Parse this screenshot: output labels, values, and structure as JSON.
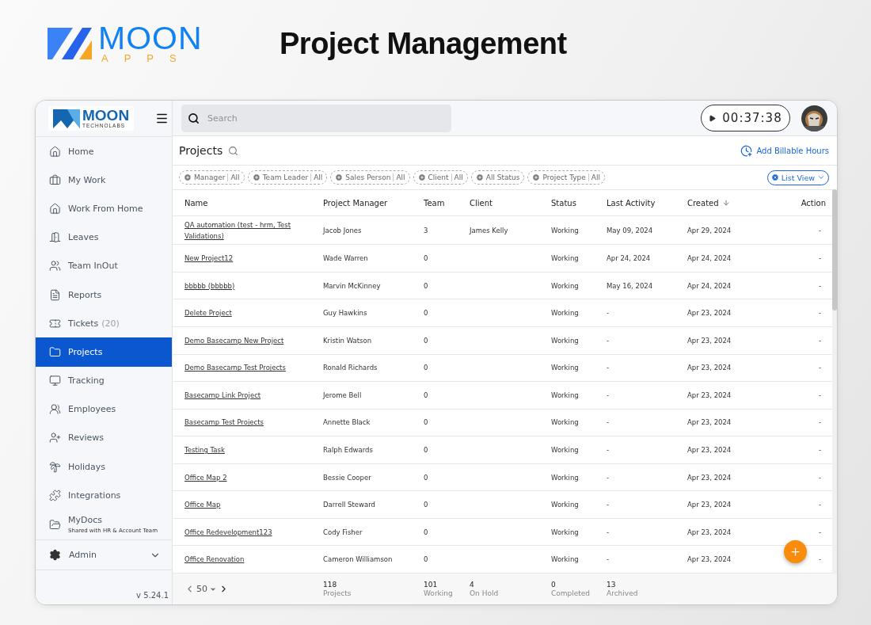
{
  "brand": {
    "name": "MOON",
    "tagline": "APPS"
  },
  "headline": "Project Management",
  "app": {
    "logo": {
      "name": "MOON",
      "sub": "TECHNOLABS"
    },
    "search": {
      "placeholder": "Search"
    },
    "timer": {
      "time": "00:37:38"
    },
    "sidebar": {
      "items": [
        {
          "label": "Home",
          "selected": false
        },
        {
          "label": "My Work",
          "selected": false
        },
        {
          "label": "Work From Home",
          "selected": false
        },
        {
          "label": "Leaves",
          "selected": false
        },
        {
          "label": "Team InOut",
          "selected": false
        },
        {
          "label": "Reports",
          "selected": false
        },
        {
          "label": "Tickets",
          "count": "(20)",
          "selected": false
        },
        {
          "label": "Projects",
          "selected": true
        },
        {
          "label": "Tracking",
          "selected": false
        },
        {
          "label": "Employees",
          "selected": false
        },
        {
          "label": "Reviews",
          "selected": false
        },
        {
          "label": "Holidays",
          "selected": false
        },
        {
          "label": "Integrations",
          "selected": false
        },
        {
          "label": "MyDocs",
          "note": "Shared with HR & Account Team",
          "selected": false
        }
      ],
      "admin": {
        "label": "Admin",
        "expanded": false
      },
      "version": "v 5.24.1"
    },
    "page": {
      "title": "Projects",
      "action": "Add Billable Hours",
      "view": "List View",
      "filters": [
        {
          "label": "Manager",
          "value": "All"
        },
        {
          "label": "Team Leader",
          "value": "All"
        },
        {
          "label": "Sales Person",
          "value": "All"
        },
        {
          "label": "Client",
          "value": "All"
        },
        {
          "label": "All Status"
        },
        {
          "label": "Project Type",
          "value": "All"
        }
      ]
    },
    "table": {
      "columns": [
        {
          "label": "Name"
        },
        {
          "label": "Project Manager"
        },
        {
          "label": "Team"
        },
        {
          "label": "Client"
        },
        {
          "label": "Status"
        },
        {
          "label": "Last Activity"
        },
        {
          "label": "Created",
          "sorted": true
        },
        {
          "label": "Action"
        }
      ],
      "rows": [
        {
          "name": "QA automation (test - hrm, Test Validations)",
          "manager": "Jacob Jones",
          "team": "3",
          "client": "James Kelly",
          "status": "Working",
          "last_activity": "May 09, 2024",
          "created": "Apr 29, 2024",
          "action": "-"
        },
        {
          "name": "New Project12",
          "manager": "Wade Warren",
          "team": "0",
          "status": "Working",
          "last_activity": "Apr 24, 2024",
          "created": "Apr 24, 2024",
          "action": "-"
        },
        {
          "name": "bbbbb (bbbbb)",
          "manager": "Marvin McKinney",
          "team": "0",
          "status": "Working",
          "last_activity": "May 16, 2024",
          "created": "Apr 24, 2024",
          "action": "-"
        },
        {
          "name": "Delete Project",
          "manager": "Guy Hawkins",
          "team": "0",
          "status": "Working",
          "last_activity": "-",
          "created": "Apr 23, 2024",
          "action": "-"
        },
        {
          "name": "Demo Basecamp New Project",
          "manager": "Kristin Watson",
          "team": "0",
          "status": "Working",
          "last_activity": "-",
          "created": "Apr 23, 2024",
          "action": "-"
        },
        {
          "name": "Demo Basecamp Test Projects",
          "manager": "Ronald Richards",
          "team": "0",
          "status": "Working",
          "last_activity": "-",
          "created": "Apr 23, 2024",
          "action": "-"
        },
        {
          "name": "Basecamp Link Project",
          "manager": "Jerome Bell",
          "team": "0",
          "status": "Working",
          "last_activity": "-",
          "created": "Apr 23, 2024",
          "action": "-"
        },
        {
          "name": "Basecamp Test Projects",
          "manager": "Annette Black",
          "team": "0",
          "status": "Working",
          "last_activity": "-",
          "created": "Apr 23, 2024",
          "action": "-"
        },
        {
          "name": "Testing Task",
          "manager": "Ralph Edwards",
          "team": "0",
          "status": "Working",
          "last_activity": "-",
          "created": "Apr 23, 2024",
          "action": "-"
        },
        {
          "name": "Office Map 2",
          "manager": "Bessie Cooper",
          "team": "0",
          "status": "Working",
          "last_activity": "-",
          "created": "Apr 23, 2024",
          "action": "-"
        },
        {
          "name": "Office Map",
          "manager": "Darrell Steward",
          "team": "0",
          "status": "Working",
          "last_activity": "-",
          "created": "Apr 23, 2024",
          "action": "-"
        },
        {
          "name": "Office Redevelopment123",
          "manager": "Cody Fisher",
          "team": "0",
          "status": "Working",
          "last_activity": "-",
          "created": "Apr 23, 2024",
          "action": "-"
        },
        {
          "name": "Office Renovation",
          "manager": "Cameron Williamson",
          "team": "0",
          "status": "Working",
          "last_activity": "-",
          "created": "Apr 23, 2024",
          "action": "-"
        }
      ]
    },
    "footer": {
      "page_size": "50",
      "stats": [
        {
          "value": "118",
          "label": "Projects"
        },
        {
          "value": "101",
          "label": "Working"
        },
        {
          "value": "4",
          "label": "On Hold"
        },
        {
          "value": "0",
          "label": "Completed"
        },
        {
          "value": "13",
          "label": "Archived"
        }
      ]
    }
  }
}
